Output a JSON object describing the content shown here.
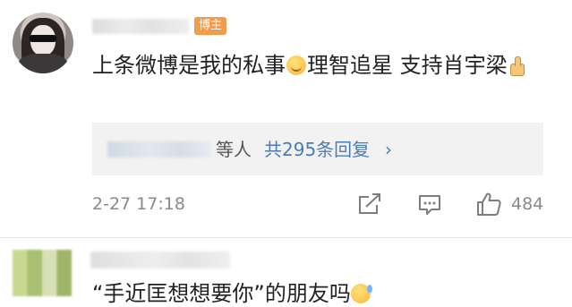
{
  "comment": {
    "owner_badge": "博主",
    "text_part1": "上条微博是我的私事",
    "text_part2": "理智追星 支持肖宇梁",
    "emoji_smile": "smile-emoji",
    "emoji_thumb": "thumbs-up-emoji",
    "reply_etc": "等人",
    "reply_count_label": "共295条回复",
    "reply_chevron": "›",
    "timestamp": "2-27 17:18",
    "like_count": "484"
  },
  "comment2": {
    "text": "“手近匡想想要你”的朋友吗",
    "emoji": "sweat-emoji"
  },
  "icons": [
    "share-icon",
    "comment-icon",
    "like-icon"
  ],
  "colors": {
    "badge": "#f29c4b",
    "link": "#4a7db8",
    "meta_text": "#8a8a8a",
    "reply_box_bg": "#f2f2f2"
  }
}
